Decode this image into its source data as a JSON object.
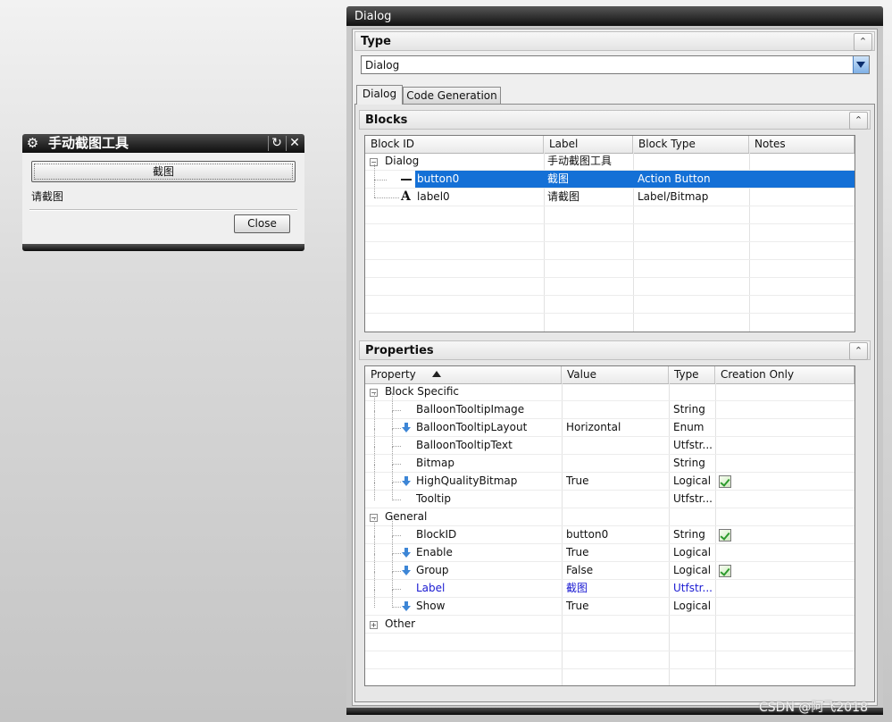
{
  "mini_dialog": {
    "title": "手动截图工具",
    "button_label": "截图",
    "label_text": "请截图",
    "close_label": "Close"
  },
  "main_dialog": {
    "title": "Dialog",
    "type_group": {
      "title": "Type",
      "selected": "Dialog"
    },
    "tabs": [
      {
        "label": "Dialog",
        "active": true
      },
      {
        "label": "Code Generation",
        "active": false
      }
    ],
    "blocks": {
      "title": "Blocks",
      "columns": [
        "Block ID",
        "Label",
        "Block Type",
        "Notes"
      ],
      "rows": [
        {
          "id": "Dialog",
          "label": "手动截图工具",
          "type": "",
          "notes": "",
          "level": 0,
          "icon": "collapse-icon"
        },
        {
          "id": "button0",
          "label": "截图",
          "type": "Action Button",
          "notes": "",
          "level": 1,
          "icon": "button-block-icon",
          "selected": true
        },
        {
          "id": "label0",
          "label": "请截图",
          "type": "Label/Bitmap",
          "notes": "",
          "level": 1,
          "icon": "label-block-icon"
        }
      ]
    },
    "properties": {
      "title": "Properties",
      "columns": [
        "Property",
        "Value",
        "Type",
        "Creation Only"
      ],
      "rows": [
        {
          "name": "Block Specific",
          "value": "",
          "type": "",
          "group": true,
          "expanded": true
        },
        {
          "name": "BalloonTooltipImage",
          "value": "",
          "type": "String"
        },
        {
          "name": "BalloonTooltipLayout",
          "value": "Horizontal",
          "type": "Enum",
          "arrow": true
        },
        {
          "name": "BalloonTooltipText",
          "value": "",
          "type": "Utfstr..."
        },
        {
          "name": "Bitmap",
          "value": "",
          "type": "String"
        },
        {
          "name": "HighQualityBitmap",
          "value": "True",
          "type": "Logical",
          "arrow": true,
          "creation_only": true
        },
        {
          "name": "Tooltip",
          "value": "",
          "type": "Utfstr..."
        },
        {
          "name": "General",
          "value": "",
          "type": "",
          "group": true,
          "expanded": true
        },
        {
          "name": "BlockID",
          "value": "button0",
          "type": "String",
          "creation_only": true
        },
        {
          "name": "Enable",
          "value": "True",
          "type": "Logical",
          "arrow": true
        },
        {
          "name": "Group",
          "value": "False",
          "type": "Logical",
          "arrow": true,
          "creation_only": true
        },
        {
          "name": "Label",
          "value": "截图",
          "type": "Utfstr...",
          "highlight": true
        },
        {
          "name": "Show",
          "value": "True",
          "type": "Logical",
          "arrow": true
        },
        {
          "name": "Other",
          "value": "",
          "type": "",
          "group": true,
          "expanded": false
        }
      ]
    }
  },
  "watermark": "CSDN @阿飞2018"
}
